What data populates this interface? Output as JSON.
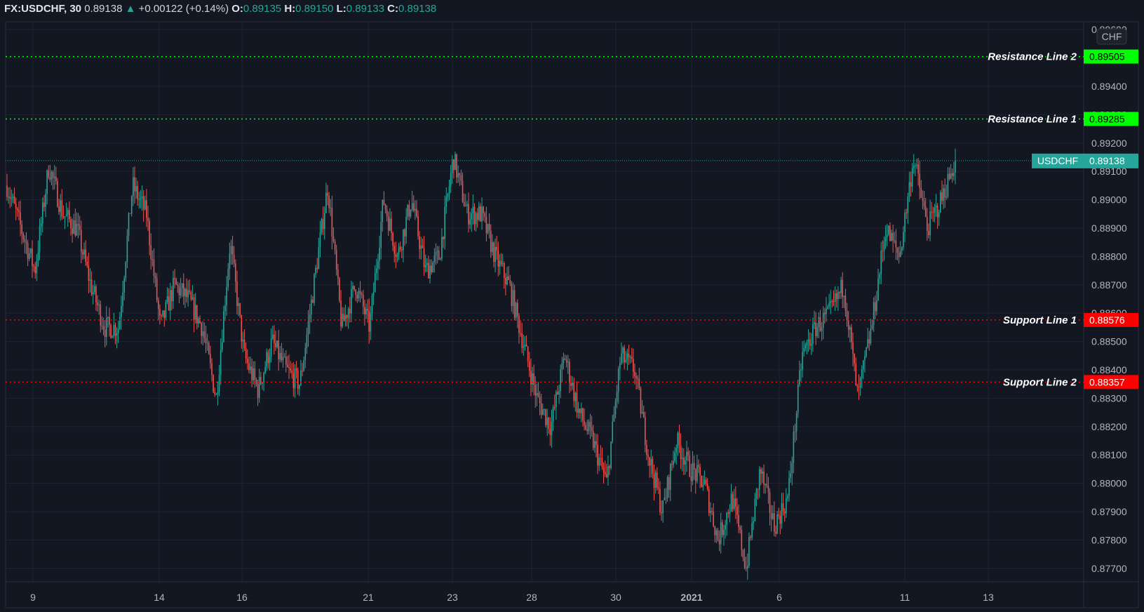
{
  "header": {
    "symbol": "FX:USDCHF, 30",
    "last": "0.89138",
    "change": "+0.00122 (+0.14%)",
    "open_label": "O:",
    "open": "0.89135",
    "high_label": "H:",
    "high": "0.89150",
    "low_label": "L:",
    "low": "0.89133",
    "close_label": "C:",
    "close": "0.89138",
    "direction_icon": "triangle-up-icon"
  },
  "currency_badge": "CHF",
  "colors": {
    "background": "#131722",
    "up": "#26a69a",
    "down": "#ef5350",
    "resistance": "#00ff00",
    "support": "#ff0000",
    "last_price": "#26a69a"
  },
  "chart_data": {
    "type": "candlestick",
    "symbol": "USDCHF",
    "timeframe": "30",
    "ylim": [
      0.8767,
      0.8963
    ],
    "y_ticks": [
      "0.87700",
      "0.87800",
      "0.87900",
      "0.88000",
      "0.88100",
      "0.88200",
      "0.88300",
      "0.88400",
      "0.88500",
      "0.88600",
      "0.88700",
      "0.88800",
      "0.88900",
      "0.89000",
      "0.89100",
      "0.89200",
      "0.89300",
      "0.89400",
      "0.89500",
      "0.89600"
    ],
    "x_ticks": [
      "9",
      "14",
      "16",
      "21",
      "23",
      "28",
      "30",
      "2021",
      "6",
      "11",
      "13"
    ],
    "grid": true,
    "approx_close_path": [
      0.8905,
      0.889,
      0.8875,
      0.8912,
      0.8895,
      0.889,
      0.887,
      0.8855,
      0.8855,
      0.8905,
      0.8895,
      0.8855,
      0.887,
      0.8865,
      0.8855,
      0.883,
      0.8885,
      0.8845,
      0.8833,
      0.885,
      0.884,
      0.8835,
      0.887,
      0.8905,
      0.8855,
      0.887,
      0.8855,
      0.89,
      0.888,
      0.89,
      0.8875,
      0.888,
      0.8915,
      0.8895,
      0.8895,
      0.888,
      0.887,
      0.885,
      0.883,
      0.882,
      0.8845,
      0.8825,
      0.8815,
      0.88,
      0.8845,
      0.884,
      0.881,
      0.879,
      0.8815,
      0.8805,
      0.88,
      0.878,
      0.8795,
      0.877,
      0.8805,
      0.8785,
      0.8795,
      0.8845,
      0.8855,
      0.886,
      0.887,
      0.883,
      0.8855,
      0.889,
      0.888,
      0.8915,
      0.889,
      0.89,
      0.89138
    ],
    "last_price": {
      "label": "USDCHF",
      "value": 0.89138,
      "text": "0.89138"
    },
    "horizontal_lines": [
      {
        "name": "Resistance Line 2",
        "value": 0.89505,
        "text": "0.89505",
        "kind": "resistance"
      },
      {
        "name": "Resistance Line 1",
        "value": 0.89285,
        "text": "0.89285",
        "kind": "resistance"
      },
      {
        "name": "Support Line 1",
        "value": 0.88576,
        "text": "0.88576",
        "kind": "support"
      },
      {
        "name": "Support Line 2",
        "value": 0.88357,
        "text": "0.88357",
        "kind": "support"
      }
    ]
  }
}
